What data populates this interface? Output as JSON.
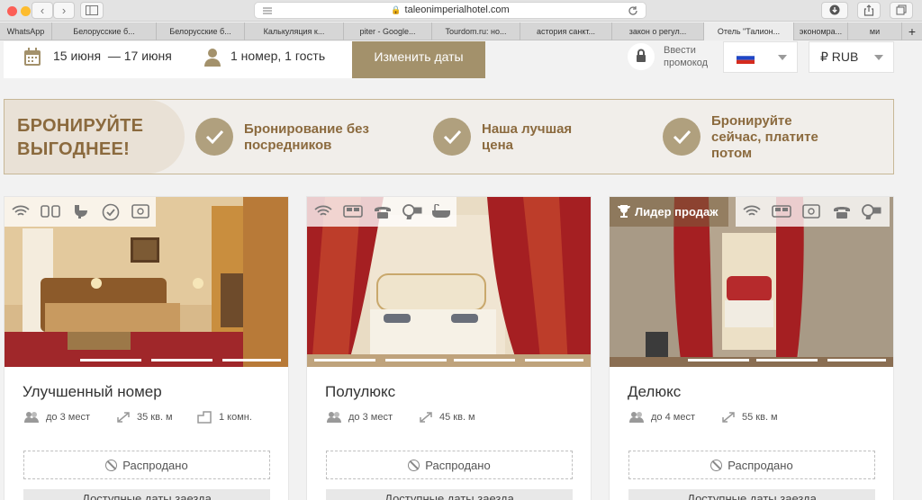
{
  "browser": {
    "url": "taleonimperialhotel.com",
    "tabs": [
      "WhatsApp",
      "Белорусские б...",
      "Белорусские б...",
      "Калькуляция к...",
      "piter - Google...",
      "Tourdom.ru: но...",
      "астория санкт...",
      "закон о регул...",
      "Отель \"Талион...",
      "экономра...",
      "ми"
    ],
    "active_tab": 8
  },
  "search": {
    "dates": "15 июня  — 17 июня",
    "guests": "1 номер, 1 гость",
    "change_dates_label": "Изменить даты",
    "promo_label": "Ввести промокод",
    "currency": "₽ RUB"
  },
  "banner": {
    "title_line1": "БРОНИРУЙТЕ",
    "title_line2": "ВЫГОДНЕЕ!",
    "benefits": [
      {
        "line1": "Бронирование без",
        "line2": "посредников"
      },
      {
        "line1": "Наша лучшая",
        "line2": "цена"
      },
      {
        "line1": "Бронируйте",
        "line2": "сейчас, платите",
        "line3": "потом"
      }
    ]
  },
  "rooms": [
    {
      "name": "Улучшенный номер",
      "capacity": "до 3 мест",
      "area": "35 кв. м",
      "rooms": "1 комн.",
      "status": "Распродано",
      "avail_label": "Доступные даты заезда"
    },
    {
      "name": "Полулюкс",
      "capacity": "до 3 мест",
      "area": "45 кв. м",
      "status": "Распродано",
      "avail_label": "Доступные даты заезда"
    },
    {
      "name": "Делюкс",
      "capacity": "до 4 мест",
      "area": "55 кв. м",
      "status": "Распродано",
      "avail_label": "Доступные даты заезда",
      "badge": "Лидер продаж"
    }
  ],
  "colors": {
    "accent": "#a3916b",
    "accent_text": "#8b6a3e",
    "banner_bg": "#f1eeea"
  }
}
